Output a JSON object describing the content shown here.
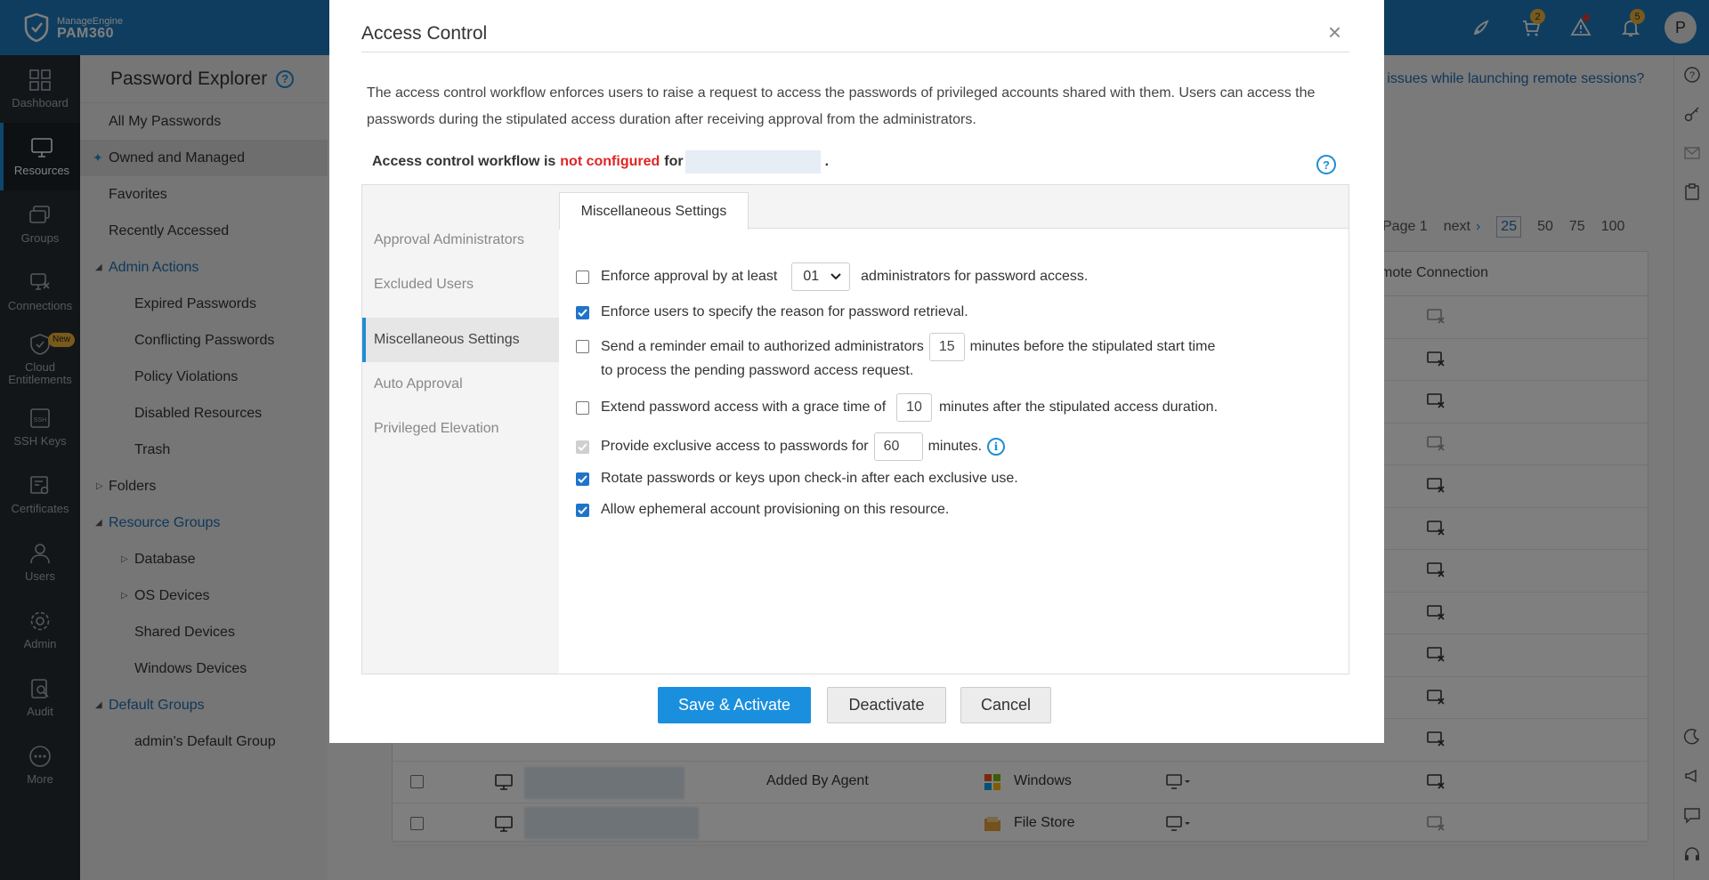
{
  "app": {
    "vendor": "ManageEngine",
    "product": "PAM360",
    "user_initial": "P",
    "badges": {
      "cart": "2",
      "notifications": "5"
    }
  },
  "leftnav": [
    {
      "id": "dashboard",
      "label": "Dashboard"
    },
    {
      "id": "resources",
      "label": "Resources"
    },
    {
      "id": "groups",
      "label": "Groups"
    },
    {
      "id": "connections",
      "label": "Connections"
    },
    {
      "id": "cloud",
      "label": "Cloud Entitlements",
      "badge": "New"
    },
    {
      "id": "ssh",
      "label": "SSH Keys"
    },
    {
      "id": "certificates",
      "label": "Certificates"
    },
    {
      "id": "users",
      "label": "Users"
    },
    {
      "id": "admin",
      "label": "Admin"
    },
    {
      "id": "audit",
      "label": "Audit"
    },
    {
      "id": "more",
      "label": "More"
    }
  ],
  "explorer": {
    "title": "Password Explorer",
    "items": [
      {
        "label": "All My Passwords",
        "level": 0
      },
      {
        "label": "Owned and Managed",
        "level": 0
      },
      {
        "label": "Favorites",
        "level": 0
      },
      {
        "label": "Recently Accessed",
        "level": 0
      },
      {
        "label": "Admin Actions",
        "level": 0
      },
      {
        "label": "Expired Passwords",
        "level": 1
      },
      {
        "label": "Conflicting Passwords",
        "level": 1
      },
      {
        "label": "Policy Violations",
        "level": 1
      },
      {
        "label": "Disabled Resources",
        "level": 1
      },
      {
        "label": "Trash",
        "level": 1
      },
      {
        "label": "Folders",
        "level": 0
      },
      {
        "label": "Resource Groups",
        "level": 0
      },
      {
        "label": "Database",
        "level": 2
      },
      {
        "label": "OS Devices",
        "level": 2
      },
      {
        "label": "Shared Devices",
        "level": 1
      },
      {
        "label": "Windows Devices",
        "level": 1
      },
      {
        "label": "Default Groups",
        "level": 0
      },
      {
        "label": "admin's Default Group",
        "level": 1
      }
    ]
  },
  "background": {
    "help_link": "g issues while launching remote sessions?",
    "pager": {
      "page": "Page 1",
      "next": "next",
      "sizes": [
        "25",
        "50",
        "75",
        "100"
      ]
    },
    "column_header": "mote Connection",
    "rows": [
      {
        "description": "Added By Agent",
        "type": "Windows"
      },
      {
        "description": "",
        "type": "File Store"
      }
    ]
  },
  "modal": {
    "title": "Access Control",
    "close": "×",
    "description": "The access control workflow enforces users to raise a request to access the passwords of privileged accounts shared with them. Users can access the passwords during the stipulated access duration after receiving approval from the administrators.",
    "status_prefix": "Access control workflow is",
    "status_value": "not configured",
    "status_for": "for",
    "status_suffix": ".",
    "side_tabs": [
      "Approval Administrators",
      "Excluded Users",
      "Miscellaneous Settings",
      "Auto Approval",
      "Privileged Elevation"
    ],
    "active_tab": "Miscellaneous Settings",
    "options": {
      "enforce_approval": {
        "before": "Enforce approval by at least",
        "value": "01",
        "after": "administrators for password access.",
        "checked": false
      },
      "reason": {
        "text": "Enforce users to specify the reason for password retrieval.",
        "checked": true
      },
      "reminder": {
        "before": "Send a reminder email to authorized administrators",
        "value": "15",
        "after": "minutes before the stipulated start time",
        "line2": "to process the pending password access request.",
        "checked": false
      },
      "grace": {
        "before": "Extend password access with a grace time of",
        "value": "10",
        "after": "minutes after the stipulated access duration.",
        "checked": false
      },
      "exclusive": {
        "before": "Provide exclusive access to passwords for",
        "value": "60",
        "after": "minutes.",
        "checked": true,
        "disabled": true
      },
      "rotate": {
        "text": "Rotate passwords or keys upon check-in after each exclusive use.",
        "checked": true
      },
      "ephemeral": {
        "text": "Allow ephemeral account provisioning on this resource.",
        "checked": true
      }
    },
    "buttons": {
      "save": "Save & Activate",
      "deactivate": "Deactivate",
      "cancel": "Cancel"
    }
  },
  "colors": {
    "topbar": "#1f7bbf",
    "leftnav": "#262d33",
    "accent": "#1a8fde",
    "danger": "#e02424"
  }
}
